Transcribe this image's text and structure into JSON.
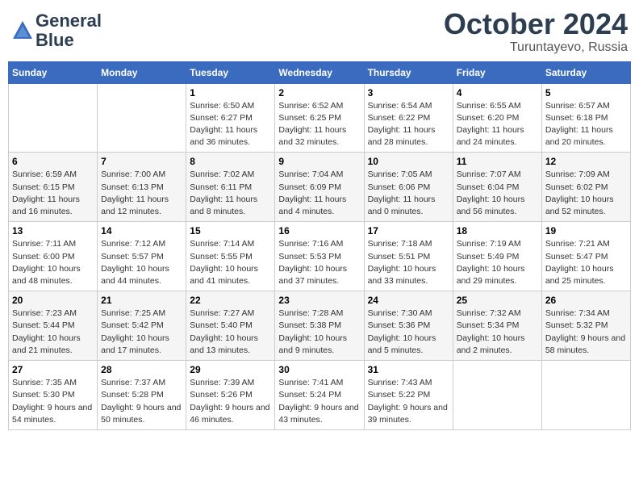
{
  "header": {
    "logo_line1": "General",
    "logo_line2": "Blue",
    "month": "October 2024",
    "location": "Turuntayevo, Russia"
  },
  "weekdays": [
    "Sunday",
    "Monday",
    "Tuesday",
    "Wednesday",
    "Thursday",
    "Friday",
    "Saturday"
  ],
  "weeks": [
    [
      {
        "day": "",
        "sunrise": "",
        "sunset": "",
        "daylight": ""
      },
      {
        "day": "",
        "sunrise": "",
        "sunset": "",
        "daylight": ""
      },
      {
        "day": "1",
        "sunrise": "Sunrise: 6:50 AM",
        "sunset": "Sunset: 6:27 PM",
        "daylight": "Daylight: 11 hours and 36 minutes."
      },
      {
        "day": "2",
        "sunrise": "Sunrise: 6:52 AM",
        "sunset": "Sunset: 6:25 PM",
        "daylight": "Daylight: 11 hours and 32 minutes."
      },
      {
        "day": "3",
        "sunrise": "Sunrise: 6:54 AM",
        "sunset": "Sunset: 6:22 PM",
        "daylight": "Daylight: 11 hours and 28 minutes."
      },
      {
        "day": "4",
        "sunrise": "Sunrise: 6:55 AM",
        "sunset": "Sunset: 6:20 PM",
        "daylight": "Daylight: 11 hours and 24 minutes."
      },
      {
        "day": "5",
        "sunrise": "Sunrise: 6:57 AM",
        "sunset": "Sunset: 6:18 PM",
        "daylight": "Daylight: 11 hours and 20 minutes."
      }
    ],
    [
      {
        "day": "6",
        "sunrise": "Sunrise: 6:59 AM",
        "sunset": "Sunset: 6:15 PM",
        "daylight": "Daylight: 11 hours and 16 minutes."
      },
      {
        "day": "7",
        "sunrise": "Sunrise: 7:00 AM",
        "sunset": "Sunset: 6:13 PM",
        "daylight": "Daylight: 11 hours and 12 minutes."
      },
      {
        "day": "8",
        "sunrise": "Sunrise: 7:02 AM",
        "sunset": "Sunset: 6:11 PM",
        "daylight": "Daylight: 11 hours and 8 minutes."
      },
      {
        "day": "9",
        "sunrise": "Sunrise: 7:04 AM",
        "sunset": "Sunset: 6:09 PM",
        "daylight": "Daylight: 11 hours and 4 minutes."
      },
      {
        "day": "10",
        "sunrise": "Sunrise: 7:05 AM",
        "sunset": "Sunset: 6:06 PM",
        "daylight": "Daylight: 11 hours and 0 minutes."
      },
      {
        "day": "11",
        "sunrise": "Sunrise: 7:07 AM",
        "sunset": "Sunset: 6:04 PM",
        "daylight": "Daylight: 10 hours and 56 minutes."
      },
      {
        "day": "12",
        "sunrise": "Sunrise: 7:09 AM",
        "sunset": "Sunset: 6:02 PM",
        "daylight": "Daylight: 10 hours and 52 minutes."
      }
    ],
    [
      {
        "day": "13",
        "sunrise": "Sunrise: 7:11 AM",
        "sunset": "Sunset: 6:00 PM",
        "daylight": "Daylight: 10 hours and 48 minutes."
      },
      {
        "day": "14",
        "sunrise": "Sunrise: 7:12 AM",
        "sunset": "Sunset: 5:57 PM",
        "daylight": "Daylight: 10 hours and 44 minutes."
      },
      {
        "day": "15",
        "sunrise": "Sunrise: 7:14 AM",
        "sunset": "Sunset: 5:55 PM",
        "daylight": "Daylight: 10 hours and 41 minutes."
      },
      {
        "day": "16",
        "sunrise": "Sunrise: 7:16 AM",
        "sunset": "Sunset: 5:53 PM",
        "daylight": "Daylight: 10 hours and 37 minutes."
      },
      {
        "day": "17",
        "sunrise": "Sunrise: 7:18 AM",
        "sunset": "Sunset: 5:51 PM",
        "daylight": "Daylight: 10 hours and 33 minutes."
      },
      {
        "day": "18",
        "sunrise": "Sunrise: 7:19 AM",
        "sunset": "Sunset: 5:49 PM",
        "daylight": "Daylight: 10 hours and 29 minutes."
      },
      {
        "day": "19",
        "sunrise": "Sunrise: 7:21 AM",
        "sunset": "Sunset: 5:47 PM",
        "daylight": "Daylight: 10 hours and 25 minutes."
      }
    ],
    [
      {
        "day": "20",
        "sunrise": "Sunrise: 7:23 AM",
        "sunset": "Sunset: 5:44 PM",
        "daylight": "Daylight: 10 hours and 21 minutes."
      },
      {
        "day": "21",
        "sunrise": "Sunrise: 7:25 AM",
        "sunset": "Sunset: 5:42 PM",
        "daylight": "Daylight: 10 hours and 17 minutes."
      },
      {
        "day": "22",
        "sunrise": "Sunrise: 7:27 AM",
        "sunset": "Sunset: 5:40 PM",
        "daylight": "Daylight: 10 hours and 13 minutes."
      },
      {
        "day": "23",
        "sunrise": "Sunrise: 7:28 AM",
        "sunset": "Sunset: 5:38 PM",
        "daylight": "Daylight: 10 hours and 9 minutes."
      },
      {
        "day": "24",
        "sunrise": "Sunrise: 7:30 AM",
        "sunset": "Sunset: 5:36 PM",
        "daylight": "Daylight: 10 hours and 5 minutes."
      },
      {
        "day": "25",
        "sunrise": "Sunrise: 7:32 AM",
        "sunset": "Sunset: 5:34 PM",
        "daylight": "Daylight: 10 hours and 2 minutes."
      },
      {
        "day": "26",
        "sunrise": "Sunrise: 7:34 AM",
        "sunset": "Sunset: 5:32 PM",
        "daylight": "Daylight: 9 hours and 58 minutes."
      }
    ],
    [
      {
        "day": "27",
        "sunrise": "Sunrise: 7:35 AM",
        "sunset": "Sunset: 5:30 PM",
        "daylight": "Daylight: 9 hours and 54 minutes."
      },
      {
        "day": "28",
        "sunrise": "Sunrise: 7:37 AM",
        "sunset": "Sunset: 5:28 PM",
        "daylight": "Daylight: 9 hours and 50 minutes."
      },
      {
        "day": "29",
        "sunrise": "Sunrise: 7:39 AM",
        "sunset": "Sunset: 5:26 PM",
        "daylight": "Daylight: 9 hours and 46 minutes."
      },
      {
        "day": "30",
        "sunrise": "Sunrise: 7:41 AM",
        "sunset": "Sunset: 5:24 PM",
        "daylight": "Daylight: 9 hours and 43 minutes."
      },
      {
        "day": "31",
        "sunrise": "Sunrise: 7:43 AM",
        "sunset": "Sunset: 5:22 PM",
        "daylight": "Daylight: 9 hours and 39 minutes."
      },
      {
        "day": "",
        "sunrise": "",
        "sunset": "",
        "daylight": ""
      },
      {
        "day": "",
        "sunrise": "",
        "sunset": "",
        "daylight": ""
      }
    ]
  ]
}
